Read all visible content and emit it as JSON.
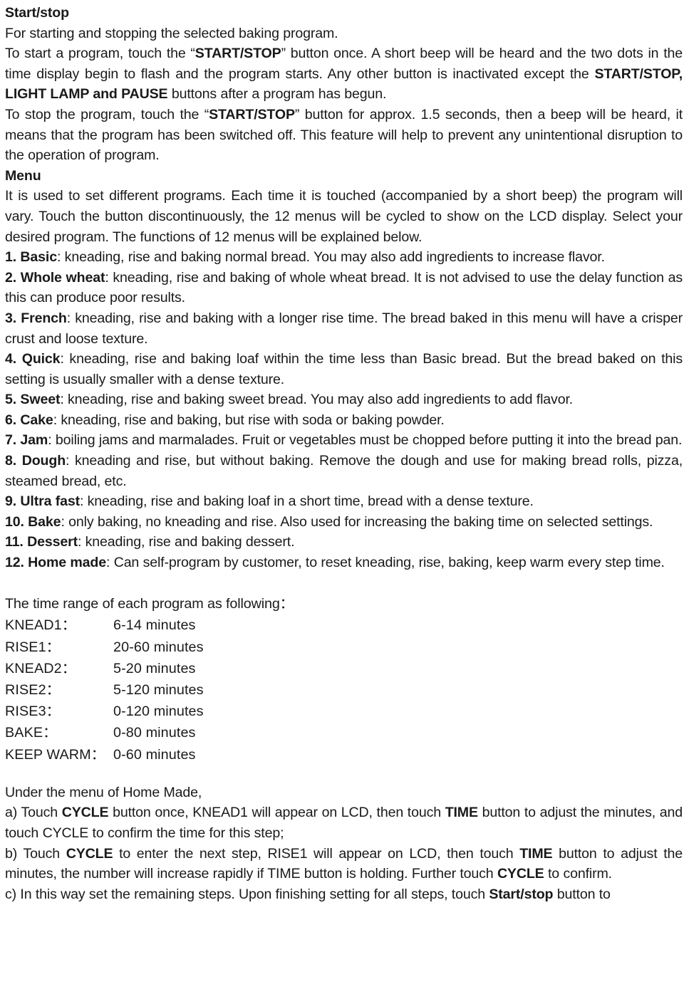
{
  "document": {
    "sections": {
      "start_stop": {
        "heading": "Start/stop",
        "line1": "For starting and stopping the selected baking program.",
        "para1_a": "To start a program, touch the “",
        "para1_b": "START/STOP",
        "para1_c": "” button once. A short beep will be heard and the two dots in the time display begin to flash and the program starts. Any other button is inactivated except the ",
        "para1_d": "START/STOP, LIGHT LAMP and PAUSE",
        "para1_e": " buttons after a program has begun.",
        "para2_a": "To stop the program, touch the “",
        "para2_b": "START/STOP",
        "para2_c": "” button for approx. 1.5 seconds, then a beep will be heard, it means that the program has been switched off. This feature will help to prevent any unintentional disruption to the operation of program."
      },
      "menu": {
        "heading": "Menu",
        "intro": "It is used to set different programs. Each time it is touched (accompanied by a short beep) the program will vary. Touch the button discontinuously, the 12 menus will be cycled to show on the LCD display. Select your desired program. The functions of 12 menus will be explained below.",
        "items": [
          {
            "label": "1. Basic",
            "text": ": kneading, rise and baking normal bread. You may also add ingredients to increase flavor."
          },
          {
            "label": "2. Whole wheat",
            "text": ": kneading, rise and baking of whole wheat bread. It is not advised to use the delay function as this can produce poor results."
          },
          {
            "label": "3. French",
            "text": ": kneading, rise and baking with a longer rise time. The bread baked in this menu will have a crisper crust and loose texture."
          },
          {
            "label": "4. Quick",
            "text": ": kneading, rise and baking loaf within the time less than Basic bread. But the bread baked on this setting is usually smaller with a dense texture."
          },
          {
            "label": "5. Sweet",
            "text": ": kneading, rise and baking sweet bread. You may also add ingredients to add flavor."
          },
          {
            "label": "6. Cake",
            "text": ": kneading, rise and baking, but rise with soda or baking powder."
          },
          {
            "label": "7. Jam",
            "text": ": boiling jams and marmalades. Fruit or vegetables must be chopped before putting it into the bread pan."
          },
          {
            "label": "8. Dough",
            "text": ": kneading and rise, but without baking. Remove the dough and use for making bread rolls, pizza, steamed bread, etc."
          },
          {
            "label": "9. Ultra fast",
            "text": ": kneading, rise and baking loaf in a short time, bread with a dense texture."
          },
          {
            "label": "10. Bake",
            "text": ": only baking, no kneading and rise. Also used for increasing the baking time on selected settings."
          },
          {
            "label": "11. Dessert",
            "text": ": kneading, rise and baking dessert."
          },
          {
            "label": "12. Home made",
            "text": ": Can self-program by customer, to reset kneading, rise, baking, keep warm every step time."
          }
        ]
      },
      "time_range": {
        "intro": "The time range of each program as following：",
        "rows": [
          {
            "label": "KNEAD1：",
            "value": "6-14 minutes"
          },
          {
            "label": "RISE1：",
            "value": "20-60 minutes"
          },
          {
            "label": "KNEAD2：",
            "value": "5-20 minutes"
          },
          {
            "label": "RISE2：",
            "value": "5-120 minutes"
          },
          {
            "label": "RISE3：",
            "value": "0-120 minutes"
          },
          {
            "label": "BAKE：",
            "value": "0-80 minutes"
          },
          {
            "label": "KEEP WARM：",
            "value": "0-60 minutes"
          }
        ]
      },
      "home_made": {
        "intro": "Under the menu of Home Made,",
        "step_a_1": "a) Touch ",
        "step_a_2": "CYCLE",
        "step_a_3": " button once, KNEAD1 will appear on LCD, then touch ",
        "step_a_4": "TIME",
        "step_a_5": " button to adjust the minutes, and touch CYCLE to confirm the time for this step;",
        "step_b_1": "b) Touch ",
        "step_b_2": "CYCLE",
        "step_b_3": " to enter the next step, RISE1 will appear on LCD, then touch ",
        "step_b_4": "TIME",
        "step_b_5": " button to adjust the minutes, the number will increase rapidly if TIME button is holding. Further touch ",
        "step_b_6": "CYCLE",
        "step_b_7": " to confirm.",
        "step_c_1": "c) In this way set the remaining steps. Upon finishing setting for all steps, touch ",
        "step_c_2": "Start/stop",
        "step_c_3": " button to"
      }
    }
  }
}
